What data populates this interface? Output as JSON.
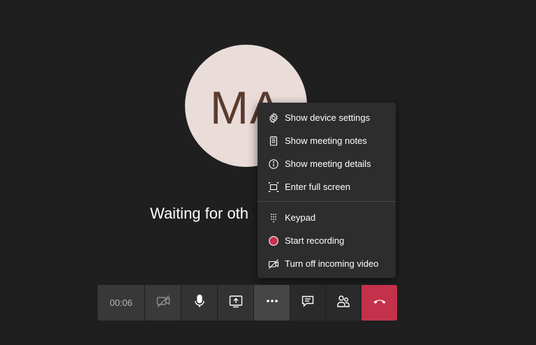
{
  "avatar": {
    "initials": "MA",
    "bg_color": "#e9dcd9",
    "text_color": "#5a3b2e"
  },
  "status": {
    "waiting_text": "Waiting for oth"
  },
  "menu": {
    "items": [
      {
        "label": "Show device settings",
        "icon": "gear-icon"
      },
      {
        "label": "Show meeting notes",
        "icon": "notes-icon"
      },
      {
        "label": "Show meeting details",
        "icon": "info-icon"
      },
      {
        "label": "Enter full screen",
        "icon": "fullscreen-icon"
      },
      {
        "label": "Keypad",
        "icon": "keypad-icon"
      },
      {
        "label": "Start recording",
        "icon": "record-icon"
      },
      {
        "label": "Turn off incoming video",
        "icon": "video-off-icon"
      }
    ]
  },
  "toolbar": {
    "timer": "00:06",
    "hangup_color": "#c4314b",
    "buttons": [
      "video-off-icon",
      "microphone-icon",
      "share-screen-icon",
      "more-options-icon",
      "chat-icon",
      "participants-icon",
      "hang-up-icon"
    ]
  },
  "colors": {
    "background": "#1f1f1f",
    "menu_bg": "#2d2d2d",
    "record_red": "#c4314b"
  }
}
